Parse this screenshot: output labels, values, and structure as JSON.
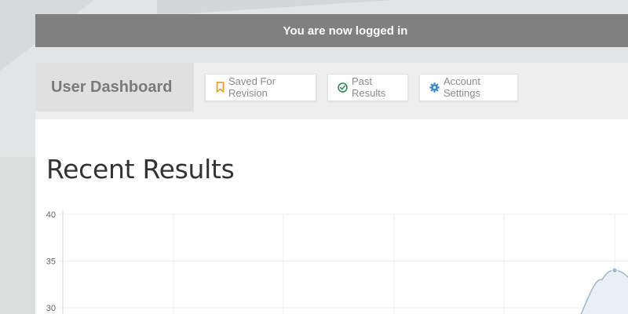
{
  "flash": {
    "message": "You are now logged in"
  },
  "nav": {
    "brand": "User Dashboard",
    "buttons": [
      {
        "label": "Saved For Revision",
        "icon": "bookmark-icon",
        "color": "#f0a030"
      },
      {
        "label": "Past Results",
        "icon": "check-circle-icon",
        "color": "#2e8b57"
      },
      {
        "label": "Account Settings",
        "icon": "gear-icon",
        "color": "#2a8ae0"
      }
    ]
  },
  "main": {
    "title": "Recent Results"
  },
  "chart_data": {
    "type": "area",
    "y_ticks": [
      40,
      35,
      30
    ],
    "ylim": [
      30,
      40
    ],
    "series": [
      {
        "values": [
          34
        ],
        "color": "#9fb8cc",
        "fill": "#e8eff5"
      }
    ],
    "grid": true
  }
}
